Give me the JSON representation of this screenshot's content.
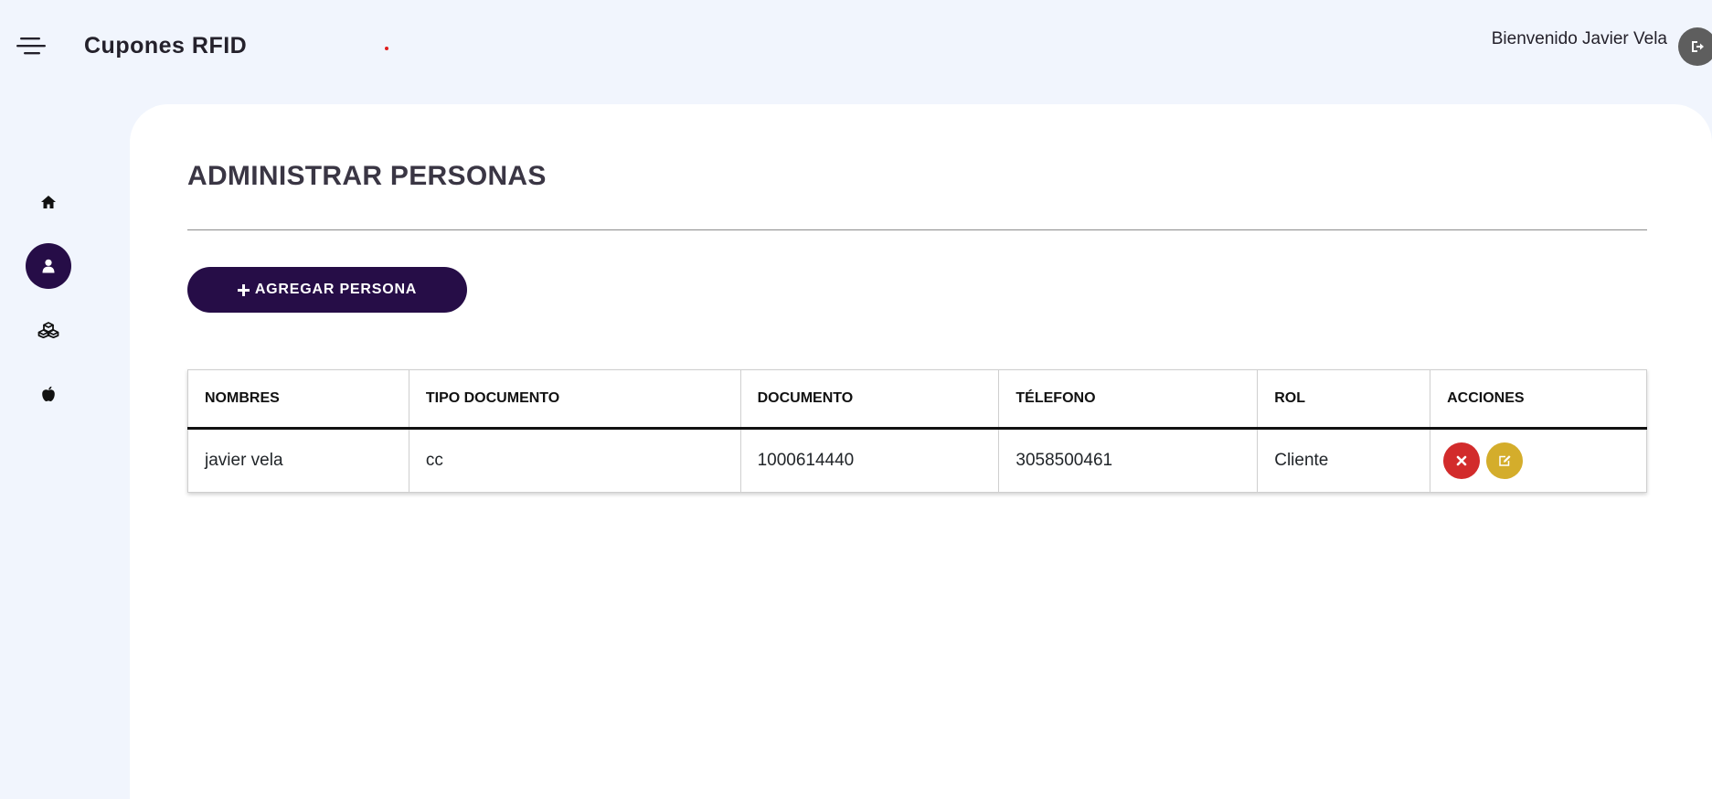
{
  "header": {
    "app_title": "Cupones RFID",
    "welcome_text": "Bienvenido Javier Vela",
    "menu_icon": "hamburger-menu-icon",
    "logout_icon": "sign-out-icon"
  },
  "sidebar": {
    "items": [
      {
        "icon": "home-icon",
        "active": false
      },
      {
        "icon": "user-icon",
        "active": true
      },
      {
        "icon": "cubes-icon",
        "active": false
      },
      {
        "icon": "apple-icon",
        "active": false
      }
    ]
  },
  "main": {
    "page_title": "ADMINISTRAR PERSONAS",
    "add_button_label": "AGREGAR PERSONA",
    "add_button_icon": "plus-icon",
    "table": {
      "headers": [
        "NOMBRES",
        "TIPO DOCUMENTO",
        "DOCUMENTO",
        "TÉLEFONO",
        "ROL",
        "ACCIONES"
      ],
      "rows": [
        {
          "nombres": "javier vela",
          "tipo_documento": "cc",
          "documento": "1000614440",
          "telefono": "3058500461",
          "rol": "Cliente",
          "actions": [
            "delete-icon",
            "edit-icon"
          ]
        }
      ]
    }
  },
  "colors": {
    "background": "#f1f5fd",
    "card": "#ffffff",
    "primary": "#260d47",
    "delete": "#d22b2b",
    "edit": "#d4ad2b",
    "logout": "#5e5e5e",
    "indicator_dot": "#e01e1e"
  }
}
